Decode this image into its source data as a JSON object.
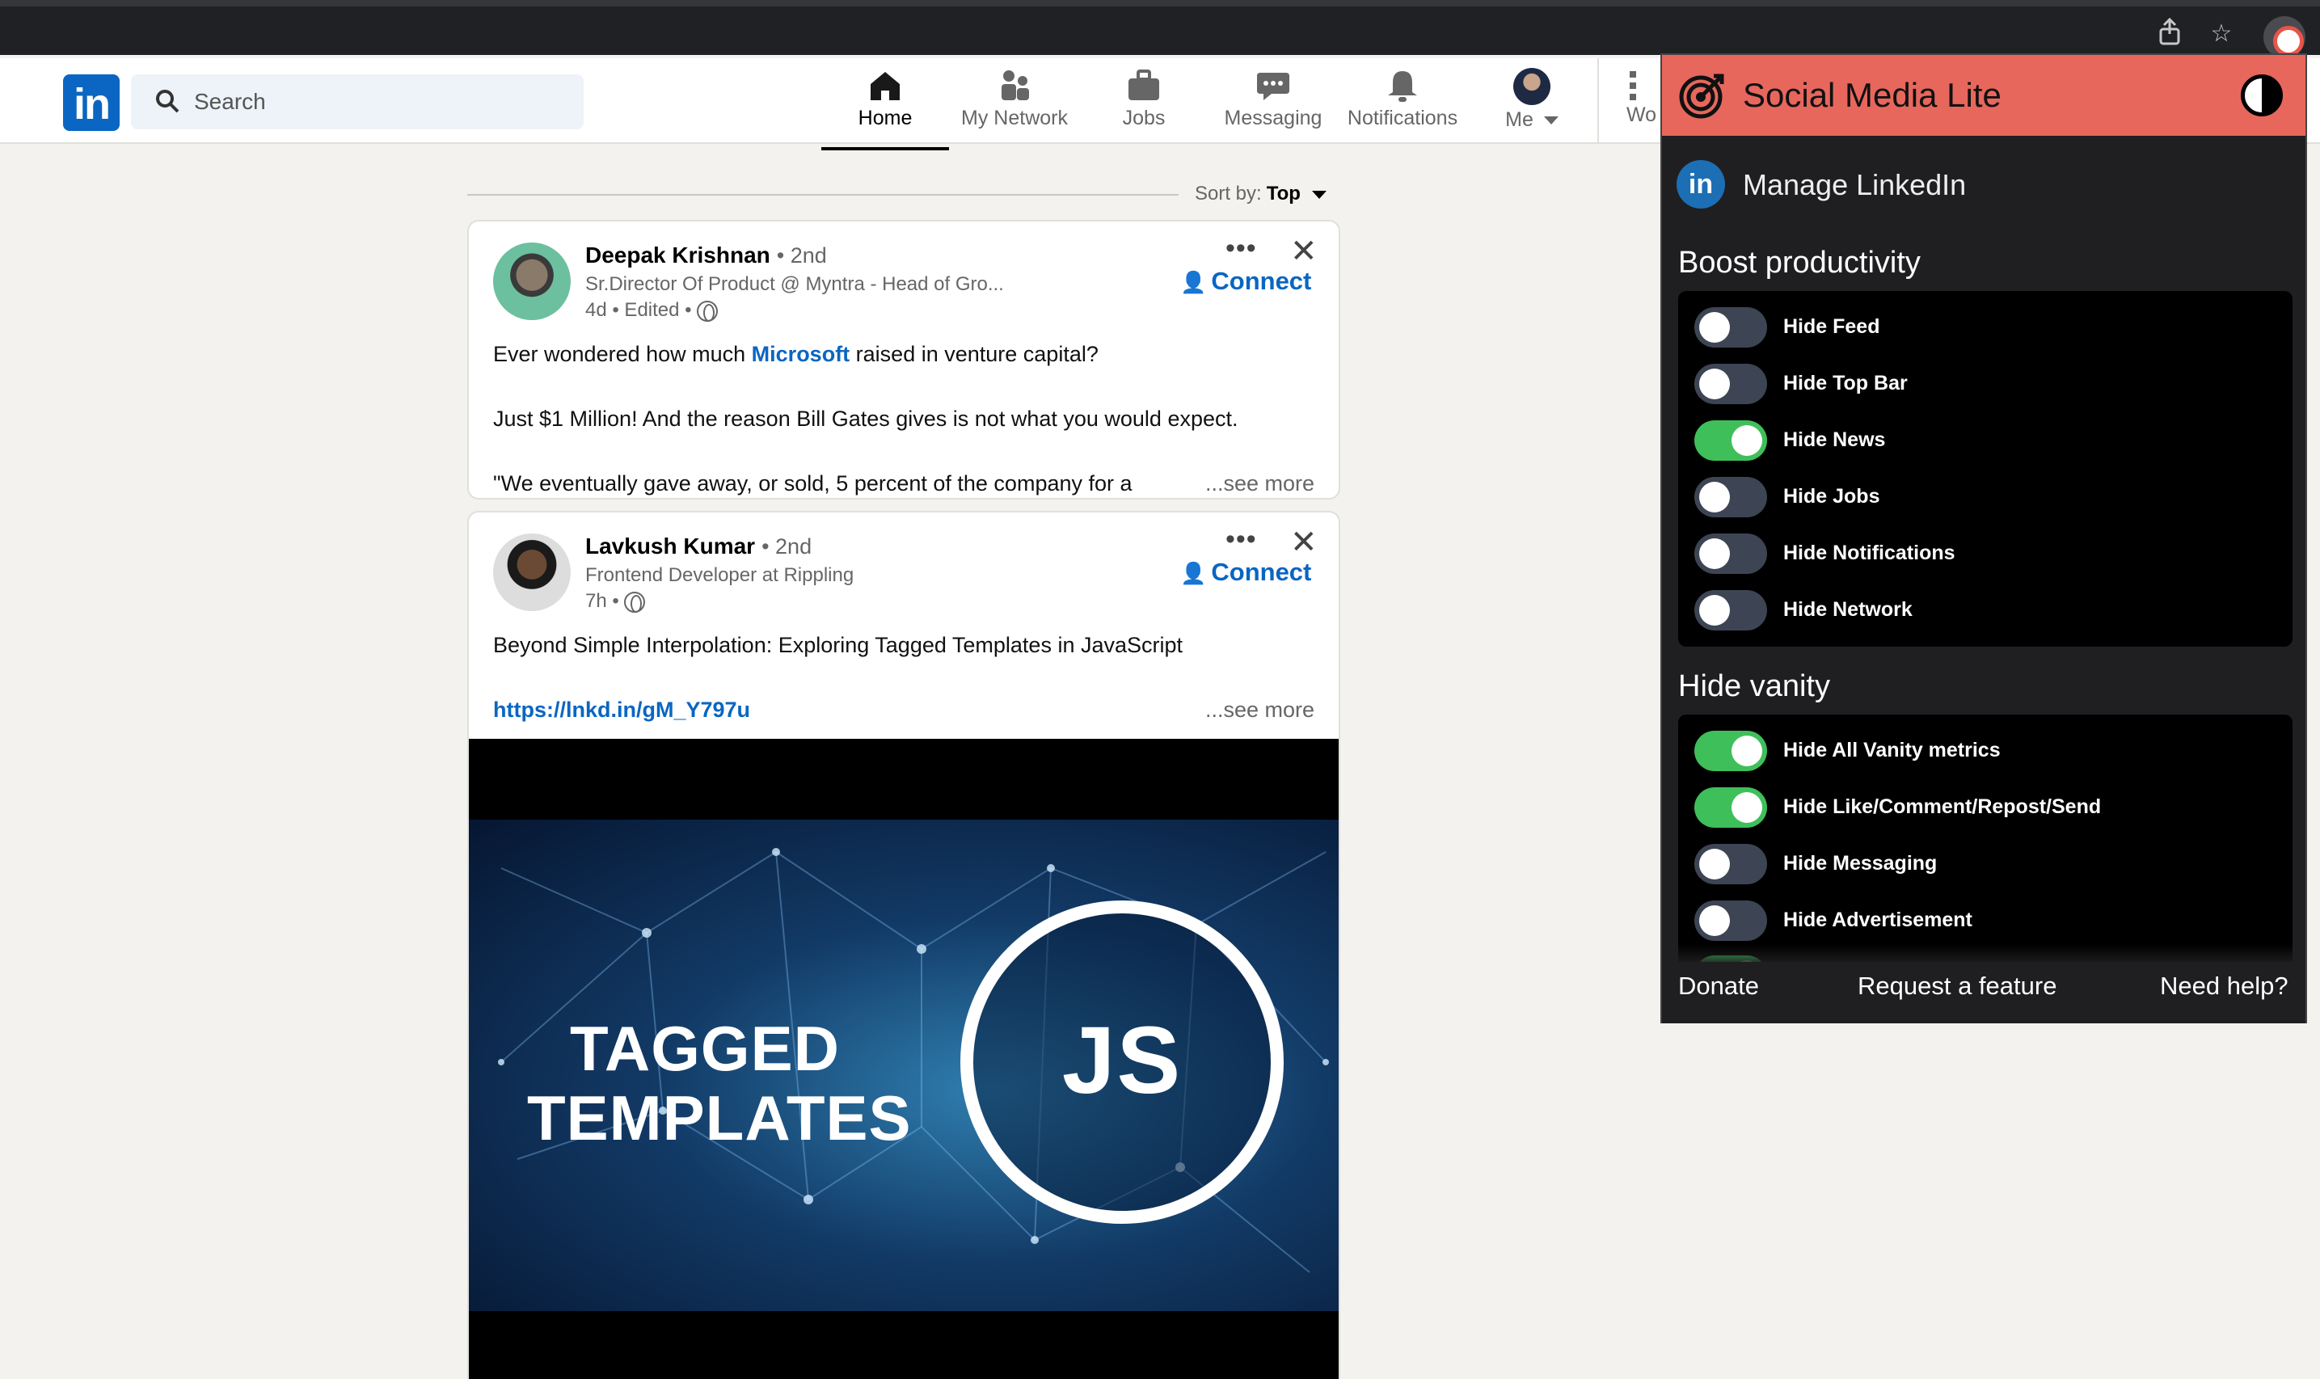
{
  "browser": {
    "share_icon": "share-icon",
    "star_icon": "star-icon",
    "extension_icon": "social-media-lite-extension-icon"
  },
  "linkedin": {
    "logo_text": "in",
    "search": {
      "placeholder": "Search",
      "value": ""
    },
    "nav": [
      {
        "label": "Home",
        "icon": "home-icon",
        "active": true
      },
      {
        "label": "My Network",
        "icon": "network-icon"
      },
      {
        "label": "Jobs",
        "icon": "briefcase-icon"
      },
      {
        "label": "Messaging",
        "icon": "chat-icon"
      },
      {
        "label": "Notifications",
        "icon": "bell-icon"
      },
      {
        "label": "Me",
        "icon": "avatar"
      },
      {
        "label": "Wo",
        "icon": "grid-icon"
      }
    ],
    "sort": {
      "label": "Sort by:",
      "value": "Top"
    },
    "posts": [
      {
        "name": "Deepak Krishnan",
        "degree": "• 2nd",
        "headline": "Sr.Director Of Product @ Myntra - Head of Gro...",
        "meta": "4d • Edited •",
        "connect_label": "Connect",
        "body_prefix": "Ever wondered how much ",
        "body_link": "Microsoft",
        "body_suffix": " raised in venture capital?",
        "body_line2": "Just $1 Million! And the reason Bill Gates gives is not what you would expect.",
        "body_line3": "\"We eventually gave away, or sold, 5 percent of the company for a",
        "see_more": "...see more"
      },
      {
        "name": "Lavkush Kumar",
        "degree": "• 2nd",
        "headline": "Frontend Developer at Rippling",
        "meta": "7h •",
        "connect_label": "Connect",
        "body_line1": "Beyond Simple Interpolation: Exploring Tagged Templates in JavaScript",
        "link": "https://lnkd.in/gM_Y797u",
        "see_more": "...see more",
        "media_title_line1": "TAGGED",
        "media_title_line2": "TEMPLATES",
        "media_badge": "JS"
      }
    ]
  },
  "extension": {
    "title": "Social Media Lite",
    "manage_label": "Manage LinkedIn",
    "sections": [
      {
        "title": "Boost productivity",
        "toggles": [
          {
            "label": "Hide Feed",
            "on": false
          },
          {
            "label": "Hide Top Bar",
            "on": false
          },
          {
            "label": "Hide News",
            "on": true
          },
          {
            "label": "Hide Jobs",
            "on": false
          },
          {
            "label": "Hide Notifications",
            "on": false
          },
          {
            "label": "Hide Network",
            "on": false
          }
        ]
      },
      {
        "title": "Hide vanity",
        "toggles": [
          {
            "label": "Hide All Vanity metrics",
            "on": true
          },
          {
            "label": "Hide Like/Comment/Repost/Send",
            "on": true
          },
          {
            "label": "Hide Messaging",
            "on": false
          },
          {
            "label": "Hide Advertisement",
            "on": false
          }
        ]
      }
    ],
    "footer": {
      "donate": "Donate",
      "request": "Request a feature",
      "help": "Need help?"
    },
    "colors": {
      "header": "#e7675d",
      "toggle_on": "#3fbf5a",
      "toggle_off": "#3d4453"
    }
  }
}
